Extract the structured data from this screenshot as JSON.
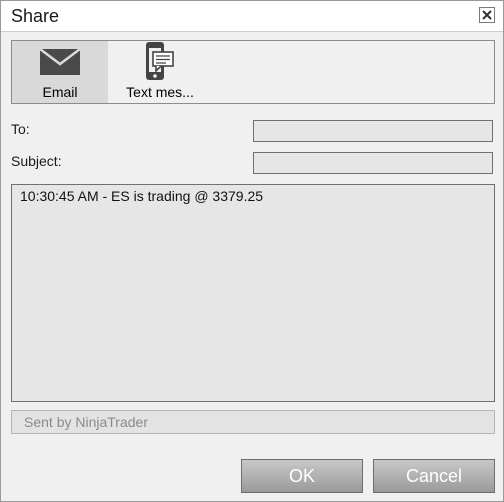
{
  "window": {
    "title": "Share"
  },
  "share_options": [
    {
      "label": "Email",
      "icon": "envelope-icon",
      "selected": true
    },
    {
      "label": "Text mes...",
      "icon": "phone-message-icon",
      "selected": false
    }
  ],
  "form": {
    "to_label": "To:",
    "to_value": "",
    "subject_label": "Subject:",
    "subject_value": "",
    "message": "10:30:45 AM - ES is trading @ 3379.25",
    "signature": "Sent by NinjaTrader"
  },
  "buttons": {
    "ok": "OK",
    "cancel": "Cancel"
  },
  "colors": {
    "selected_tab": "#d9d9d9",
    "field_bg": "#e6e6e6",
    "button_gradient_top": "#c8c8c8",
    "button_gradient_bottom": "#9a9a9a"
  }
}
